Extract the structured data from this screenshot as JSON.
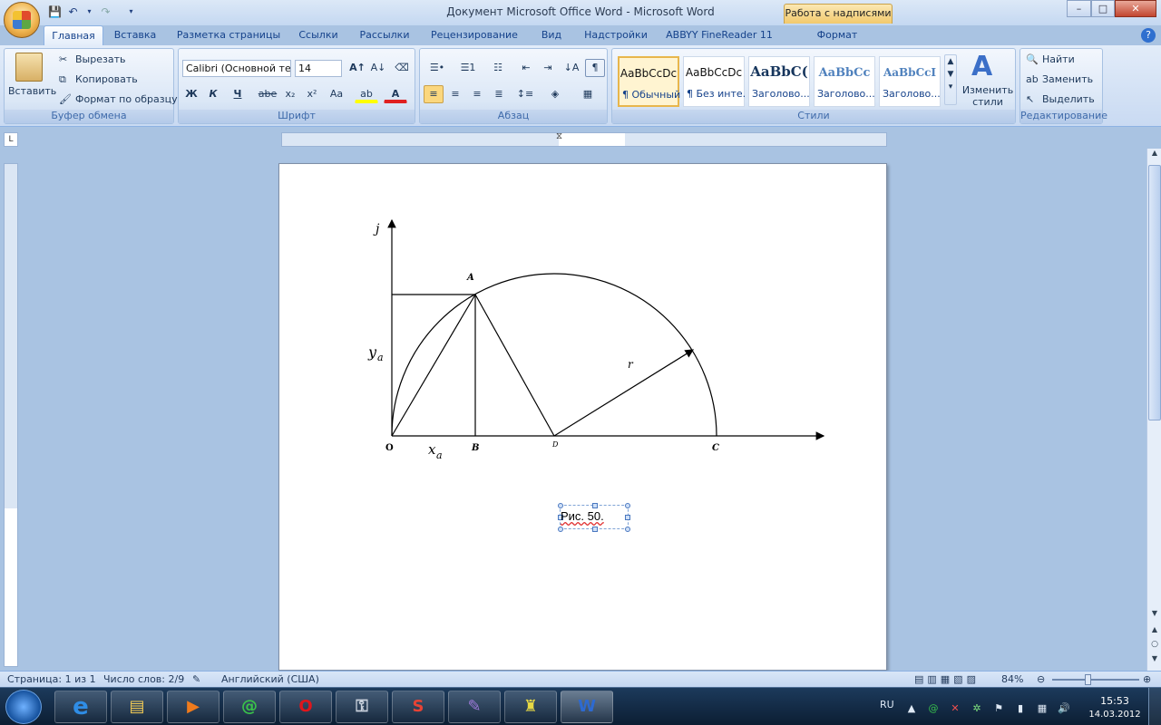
{
  "window": {
    "title": "Документ Microsoft Office Word - Microsoft Word",
    "context_tab": "Работа с надписями",
    "minimize": "–",
    "maximize": "□",
    "close": "✕"
  },
  "tabs": [
    "Главная",
    "Вставка",
    "Разметка страницы",
    "Ссылки",
    "Рассылки",
    "Рецензирование",
    "Вид",
    "Надстройки",
    "ABBYY FineReader 11",
    "Формат"
  ],
  "ribbon": {
    "clipboard": {
      "paste": "Вставить",
      "cut": "Вырезать",
      "copy": "Копировать",
      "format_painter": "Формат по образцу",
      "label": "Буфер обмена"
    },
    "font": {
      "name": "Calibri (Основной те",
      "size": "14",
      "bold": "Ж",
      "italic": "К",
      "underline": "Ч",
      "strike": "abe",
      "subscript": "x₂",
      "superscript": "x²",
      "case": "Аа",
      "label": "Шрифт"
    },
    "paragraph": {
      "label": "Абзац"
    },
    "styles": {
      "items": [
        {
          "preview": "AaBbCcDc",
          "name": "¶ Обычный"
        },
        {
          "preview": "AaBbCcDc",
          "name": "¶ Без инте..."
        },
        {
          "preview": "AaBbC(",
          "name": "Заголово..."
        },
        {
          "preview": "AaBbCc",
          "name": "Заголово..."
        },
        {
          "preview": "AaBbCcI",
          "name": "Заголово..."
        }
      ],
      "change": "Изменить стили",
      "label": "Стили"
    },
    "editing": {
      "find": "Найти",
      "replace": "Заменить",
      "select": "Выделить",
      "label": "Редактирование"
    }
  },
  "figure": {
    "labels": {
      "j": "j",
      "y": "y",
      "y_sub": "a",
      "x": "x",
      "x_sub": "a",
      "A": "A",
      "O": "O",
      "B": "B",
      "D": "D",
      "C": "C",
      "r": "r"
    },
    "caption": "Рис. 50."
  },
  "status": {
    "page": "Страница: 1 из 1",
    "words": "Число слов: 2/9",
    "language": "Английский (США)",
    "zoom": "84%"
  },
  "taskbar": {
    "lang": "RU",
    "time": "15:53",
    "date": "14.03.2012"
  }
}
